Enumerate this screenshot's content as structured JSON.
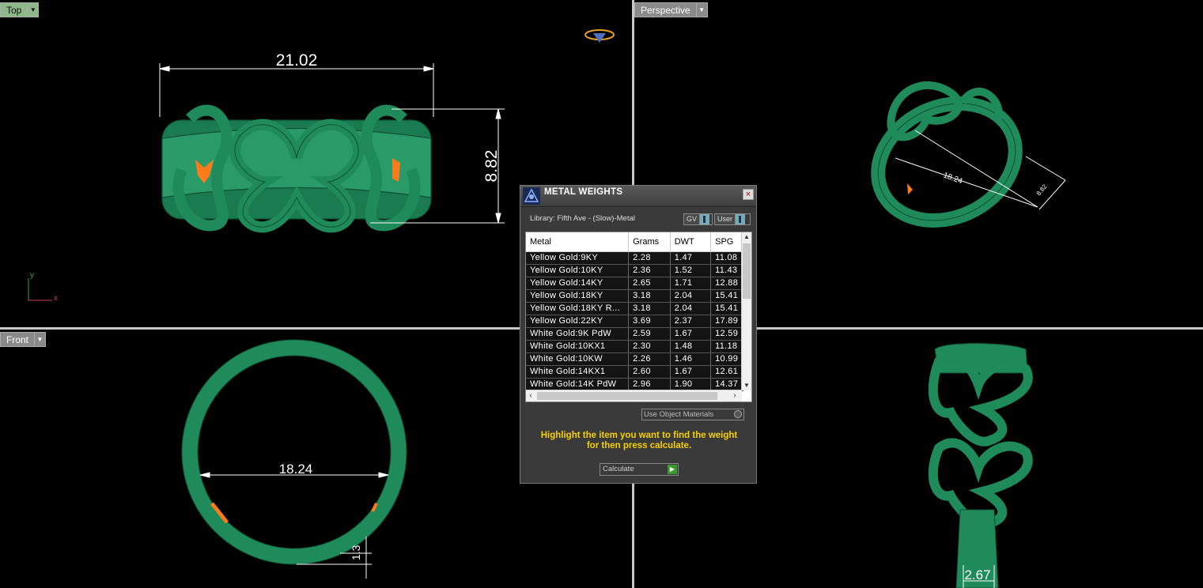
{
  "viewports": {
    "top": {
      "label": "Top",
      "dims": {
        "width": "21.02",
        "height": "8.82"
      }
    },
    "perspective": {
      "label": "Perspective",
      "dims": {
        "diameter": "18.24",
        "width": "8.82"
      }
    },
    "front": {
      "label": "Front",
      "dims": {
        "inner_diameter": "18.24",
        "thickness": "1.3"
      }
    },
    "right": {
      "dims": {
        "shank_width": "2.67"
      }
    }
  },
  "axes": {
    "y": "y",
    "x": "x"
  },
  "colors": {
    "model": "#1f8a5a",
    "accent": "#ff7a1a",
    "hint": "#f5d000"
  },
  "dialog": {
    "title": "METAL WEIGHTS",
    "close": "×",
    "library": "Library: Fifth Ave - (Slow)-Metal",
    "toggle_gv": "GV",
    "toggle_user": "User",
    "columns": [
      "Metal",
      "Grams",
      "DWT",
      "SPG"
    ],
    "rows": [
      [
        "Yellow Gold:9KY",
        "2.28",
        "1.47",
        "11.08"
      ],
      [
        "Yellow Gold:10KY",
        "2.36",
        "1.52",
        "11.43"
      ],
      [
        "Yellow Gold:14KY",
        "2.65",
        "1.71",
        "12.88"
      ],
      [
        "Yellow Gold:18KY",
        "3.18",
        "2.04",
        "15.41"
      ],
      [
        "Yellow Gold:18KY R...",
        "3.18",
        "2.04",
        "15.41"
      ],
      [
        "Yellow Gold:22KY",
        "3.69",
        "2.37",
        "17.89"
      ],
      [
        "White Gold:9K PdW",
        "2.59",
        "1.67",
        "12.59"
      ],
      [
        "White Gold:10KX1",
        "2.30",
        "1.48",
        "11.18"
      ],
      [
        "White Gold:10KW",
        "2.26",
        "1.46",
        "10.99"
      ],
      [
        "White Gold:14KX1",
        "2.60",
        "1.67",
        "12.61"
      ],
      [
        "White Gold:14K PdW",
        "2.96",
        "1.90",
        "14.37"
      ]
    ],
    "use_object_materials": "Use Object Materials",
    "hint_line1": "Highlight the item you want to find the weight",
    "hint_line2": "for then press calculate.",
    "calculate": "Calculate"
  }
}
